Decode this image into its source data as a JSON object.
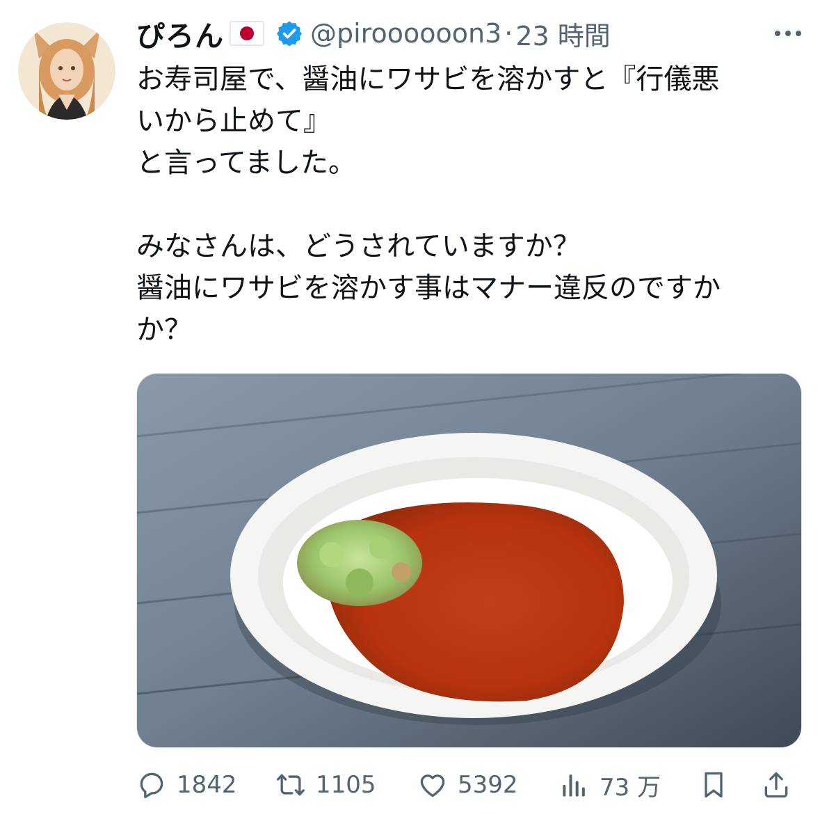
{
  "tweet": {
    "display_name": "ぴろん",
    "flag": "japan-flag",
    "verified": true,
    "handle": "@piroooooon3",
    "separator": "·",
    "timestamp": "23 時間",
    "text_lines": [
      "お寿司屋で、醤油にワサビを溶かすと『行儀悪",
      "いから止めて』",
      "と言ってました。",
      "",
      "みなさんは、どうされていますか？",
      "醤油にワサビを溶かす事はマナー違反のですか",
      "か？"
    ],
    "media": {
      "description_icon": "photo"
    }
  },
  "actions": {
    "reply_count": "1842",
    "retweet_count": "1105",
    "like_count": "5392",
    "views_count": "73 万"
  },
  "colors": {
    "text": "#0f1419",
    "secondary": "#536471",
    "verified": "#1d9bf0",
    "flag_red": "#bc002d"
  }
}
